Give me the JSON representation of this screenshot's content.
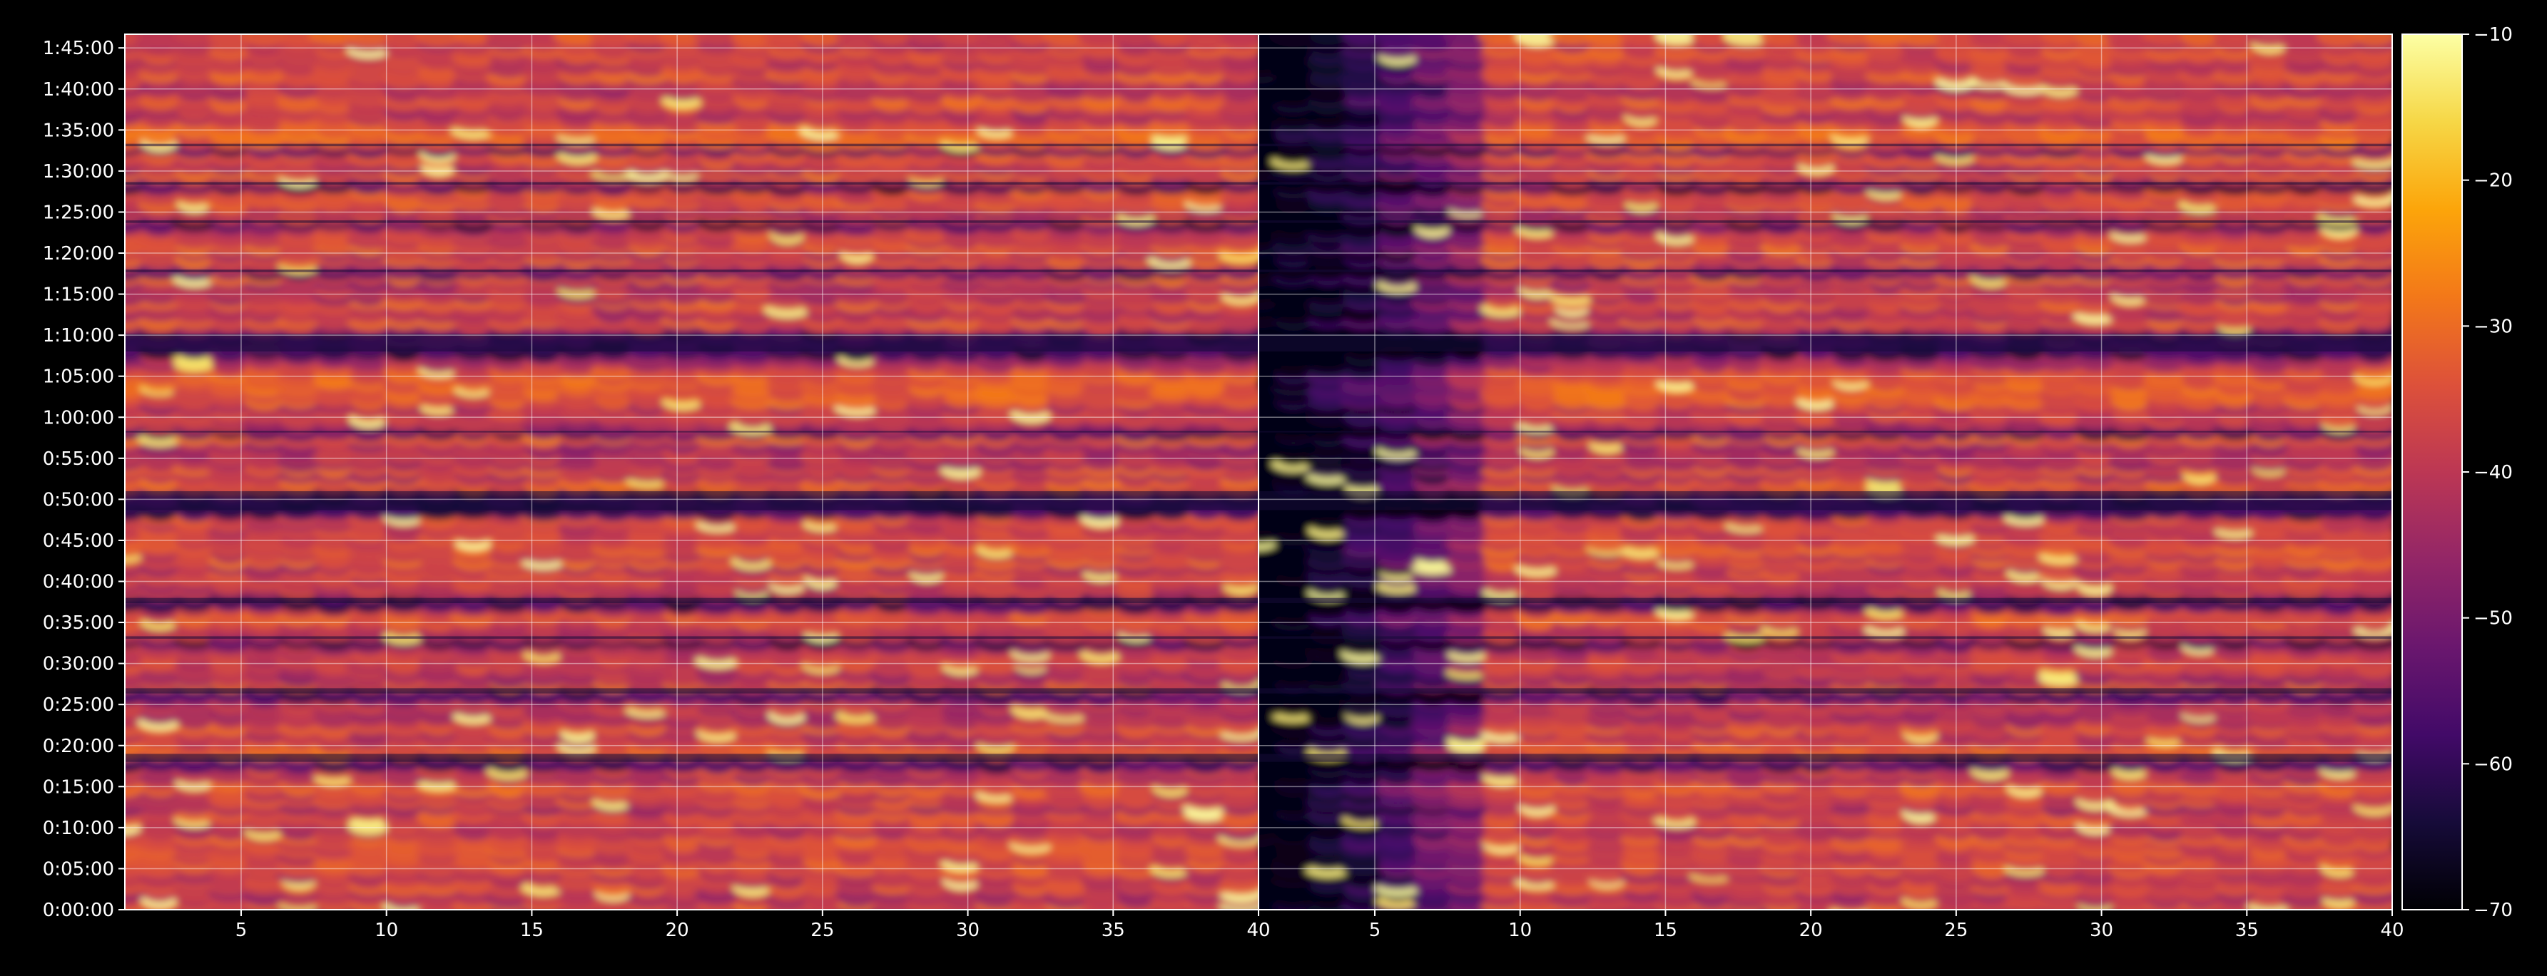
{
  "chart_data": {
    "type": "heatmap",
    "title": "",
    "xlabel": "",
    "ylabel": "",
    "colormap": "inferno",
    "background": "#000000",
    "grid": true,
    "panels": [
      {
        "name": "",
        "xlim": [
          1,
          40
        ],
        "xticks": [
          5,
          10,
          15,
          20,
          25,
          30,
          35,
          40
        ],
        "frequency_band_of_strong_signal": [
          1,
          40
        ],
        "typical_level_db": -38,
        "peak_level_db": -14
      },
      {
        "name": "",
        "xlim": [
          1,
          40
        ],
        "xticks": [
          5,
          10,
          15,
          20,
          25,
          30,
          35,
          40
        ],
        "frequency_band_of_strong_signal": [
          9,
          40
        ],
        "low_frequency_level_db": -68,
        "typical_level_db": -40,
        "peak_level_db": -14
      }
    ],
    "ylim_seconds": [
      0,
      6400
    ],
    "yticks": [
      {
        "seconds": 0,
        "label": "0:00:00"
      },
      {
        "seconds": 300,
        "label": "0:05:00"
      },
      {
        "seconds": 600,
        "label": "0:10:00"
      },
      {
        "seconds": 900,
        "label": "0:15:00"
      },
      {
        "seconds": 1200,
        "label": "0:20:00"
      },
      {
        "seconds": 1500,
        "label": "0:25:00"
      },
      {
        "seconds": 1800,
        "label": "0:30:00"
      },
      {
        "seconds": 2100,
        "label": "0:35:00"
      },
      {
        "seconds": 2400,
        "label": "0:40:00"
      },
      {
        "seconds": 2700,
        "label": "0:45:00"
      },
      {
        "seconds": 3000,
        "label": "0:50:00"
      },
      {
        "seconds": 3300,
        "label": "0:55:00"
      },
      {
        "seconds": 3600,
        "label": "1:00:00"
      },
      {
        "seconds": 3900,
        "label": "1:05:00"
      },
      {
        "seconds": 4200,
        "label": "1:10:00"
      },
      {
        "seconds": 4500,
        "label": "1:15:00"
      },
      {
        "seconds": 4800,
        "label": "1:20:00"
      },
      {
        "seconds": 5100,
        "label": "1:25:00"
      },
      {
        "seconds": 5400,
        "label": "1:30:00"
      },
      {
        "seconds": 5700,
        "label": "1:35:00"
      },
      {
        "seconds": 6000,
        "label": "1:40:00"
      },
      {
        "seconds": 6300,
        "label": "1:45:00"
      }
    ],
    "quiet_periods_seconds": [
      [
        1060,
        1160
      ],
      [
        1560,
        1640
      ],
      [
        1960,
        2020
      ],
      [
        2220,
        2300
      ],
      [
        2900,
        3080
      ],
      [
        3470,
        3520
      ],
      [
        4060,
        4230
      ],
      [
        4640,
        4700
      ],
      [
        5000,
        5060
      ],
      [
        5280,
        5340
      ],
      [
        5560,
        5620
      ]
    ],
    "colorbar": {
      "min": -70,
      "max": -10,
      "ticks": [
        -10,
        -20,
        -30,
        -40,
        -50,
        -60,
        -70
      ],
      "tick_labels": [
        "−10",
        "−20",
        "−30",
        "−40",
        "−50",
        "−60",
        "−70"
      ]
    }
  }
}
